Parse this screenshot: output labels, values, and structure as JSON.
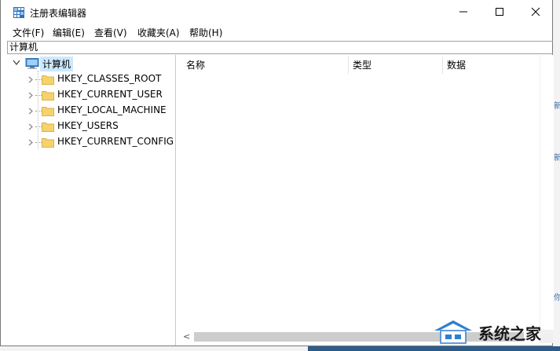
{
  "window": {
    "title": "注册表编辑器"
  },
  "menu": [
    "文件(F)",
    "编辑(E)",
    "查看(V)",
    "收藏夹(A)",
    "帮助(H)"
  ],
  "address": "计算机",
  "tree": {
    "root": "计算机",
    "children": [
      "HKEY_CLASSES_ROOT",
      "HKEY_CURRENT_USER",
      "HKEY_LOCAL_MACHINE",
      "HKEY_USERS",
      "HKEY_CURRENT_CONFIG"
    ]
  },
  "columns": [
    "名称",
    "类型",
    "数据"
  ],
  "scroll": {
    "left_arrow": "<"
  },
  "watermark": {
    "text": "系统之家"
  },
  "background": {
    "fragments": [
      "新",
      "新",
      "你"
    ]
  },
  "colors": {
    "selection": "#cce8ff",
    "folder": "#f5d26b",
    "monitor": "#3b8ed8"
  },
  "icons": [
    "registry-app-icon",
    "minimize-icon",
    "maximize-icon",
    "close-icon",
    "computer-icon",
    "folder-icon",
    "chevron-right-icon",
    "chevron-down-icon"
  ]
}
